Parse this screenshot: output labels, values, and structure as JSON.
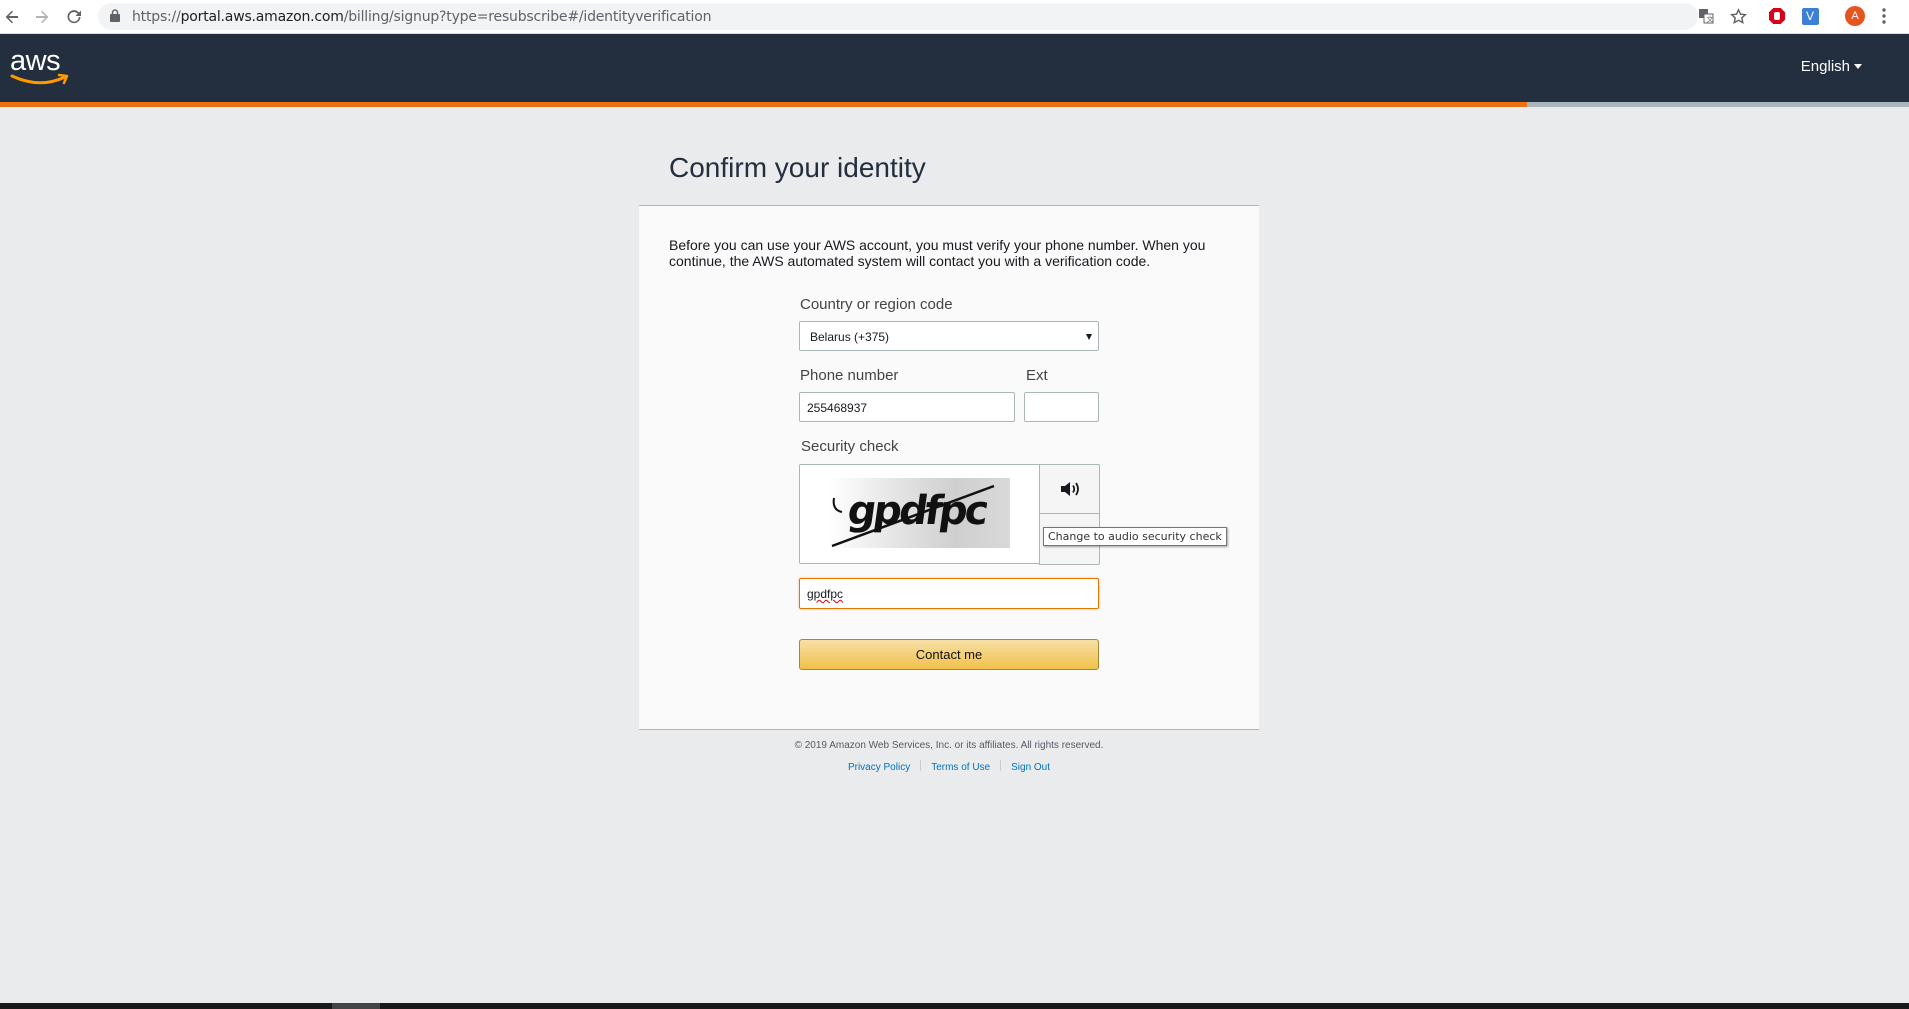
{
  "browser": {
    "url_prefix": "https://",
    "url_host": "portal.aws.amazon.com",
    "url_path": "/billing/signup?type=resubscribe#/identityverification",
    "profile_initial": "A",
    "ext_v_label": "V"
  },
  "header": {
    "logo_text": "aws",
    "language": "English",
    "progress_fraction": 0.8
  },
  "page": {
    "title": "Confirm your identity",
    "intro": "Before you can use your AWS account, you must verify your phone number. When you continue, the AWS automated system will contact you with a verification code."
  },
  "form": {
    "country_label": "Country or region code",
    "country_value": "Belarus (+375)",
    "phone_label": "Phone number",
    "phone_value": "255468937",
    "ext_label": "Ext",
    "ext_value": "",
    "security_label": "Security check",
    "captcha_text": "gpdfpc",
    "audio_tooltip": "Change to audio security check",
    "captcha_answer": "gpdfpc",
    "submit_label": "Contact me"
  },
  "footer": {
    "copyright": "© 2019 Amazon Web Services, Inc. or its affiliates. All rights reserved.",
    "links": [
      "Privacy Policy",
      "Terms of Use",
      "Sign Out"
    ]
  },
  "colors": {
    "header_bg": "#232f3e",
    "progress_orange": "#ec7211",
    "button_yellow": "#f0c14b",
    "link_blue": "#0073bb"
  }
}
